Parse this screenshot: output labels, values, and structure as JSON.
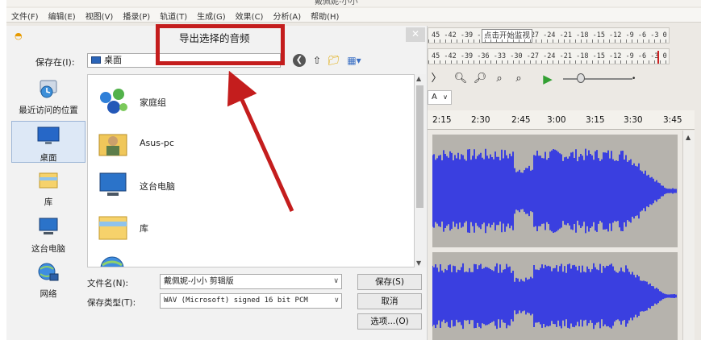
{
  "app": {
    "title": "戴佩妮-小小",
    "menu": [
      "文件(F)",
      "编辑(E)",
      "视图(V)",
      "播录(P)",
      "轨道(T)",
      "生成(G)",
      "效果(C)",
      "分析(A)",
      "帮助(H)"
    ],
    "meter_rows": [
      "45 -42 -39 -36 -33 -30 -27 -24 -21 -18 -15 -12 -9 -6 -3 0",
      "45 -42 -39 -36 -33 -30 -27 -24 -21 -18 -15 -12 -9 -6 -3 0"
    ],
    "meter_tooltip": "点击开始监视",
    "snap_value": "A",
    "timeline_ticks": [
      "2:15",
      "2:30",
      "2:45",
      "3:00",
      "3:15",
      "3:30",
      "3:45"
    ],
    "waveform_color": "#3a3fe0",
    "track_bg_color": "#b6b3ad"
  },
  "dialog": {
    "title": "导出选择的音频",
    "close_icon": "close-icon",
    "save_in_label": "保存在(I):",
    "save_in_value": "桌面",
    "places": [
      {
        "label": "最近访问的位置",
        "icon": "recent-places-icon"
      },
      {
        "label": "桌面",
        "icon": "desktop-icon"
      },
      {
        "label": "库",
        "icon": "library-icon"
      },
      {
        "label": "这台电脑",
        "icon": "computer-icon"
      },
      {
        "label": "网络",
        "icon": "network-icon"
      }
    ],
    "files": [
      {
        "name": "家庭组",
        "icon": "homegroup-icon"
      },
      {
        "name": "Asus-pc",
        "icon": "user-folder-icon"
      },
      {
        "name": "这台电脑",
        "icon": "computer-icon"
      },
      {
        "name": "库",
        "icon": "library-folder-icon"
      },
      {
        "name": "",
        "icon": "network-icon"
      }
    ],
    "filename_label": "文件名(N):",
    "filename_value": "戴佩妮-小小 剪辑版",
    "filetype_label": "保存类型(T):",
    "filetype_value": "WAV (Microsoft) signed 16 bit PCM",
    "save_button": "保存(S)",
    "cancel_button": "取消",
    "options_button": "选项...(O)"
  },
  "annotation": {
    "color": "#c41d1d"
  }
}
